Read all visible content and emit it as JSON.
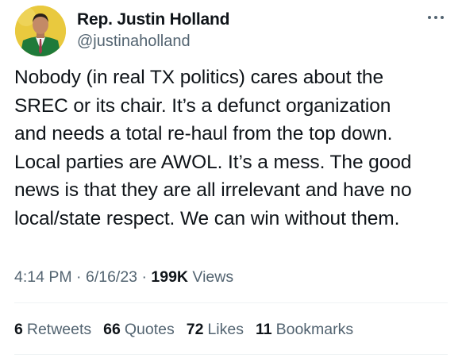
{
  "author": {
    "name": "Rep. Justin Holland",
    "handle": "@justinaholland"
  },
  "tweet": {
    "lines": [
      "Nobody (in real TX politics) cares about the",
      "SREC or its chair. It’s a defunct organization",
      "and needs a total re-haul from the top down.",
      "Local parties are AWOL. It’s a mess. The good",
      "news is that they are all irrelevant and have no",
      "local/state respect. We can win without them."
    ]
  },
  "meta": {
    "time": "4:14 PM",
    "sep1": " · ",
    "date": "6/16/23",
    "sep2": " · ",
    "views_count": "199K",
    "views_label": " Views"
  },
  "stats": {
    "retweets_count": "6",
    "retweets_label": "Retweets",
    "quotes_count": "66",
    "quotes_label": "Quotes",
    "likes_count": "72",
    "likes_label": "Likes",
    "bookmarks_count": "11",
    "bookmarks_label": "Bookmarks"
  },
  "icons": {
    "more": "more-horizontal-icon"
  },
  "colors": {
    "text": "#0f1419",
    "secondary": "#536471",
    "divider": "#eff3f4",
    "avatar_bg": "#e9c93e"
  }
}
